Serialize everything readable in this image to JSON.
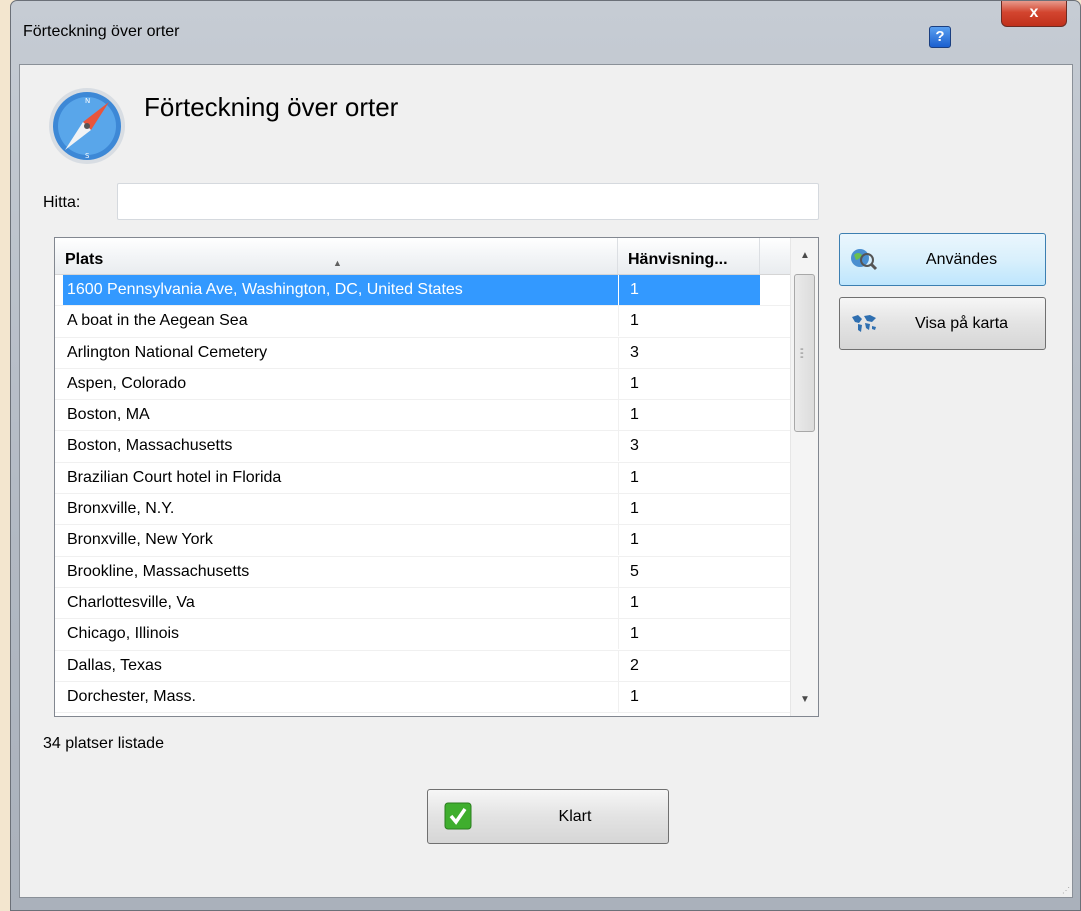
{
  "window": {
    "title": "Förteckning över orter",
    "help_label": "?",
    "close_label": "x"
  },
  "header": {
    "title": "Förteckning över orter",
    "icon": "compass-icon"
  },
  "find": {
    "label": "Hitta:",
    "value": "",
    "placeholder": ""
  },
  "table": {
    "columns": [
      "Plats",
      "Hänvisning..."
    ],
    "sort_column": "Plats",
    "selected_index": 0,
    "rows": [
      {
        "place": "1600 Pennsylvania Ave, Washington, DC, United States",
        "refs": "1"
      },
      {
        "place": "A boat in the Aegean Sea",
        "refs": "1"
      },
      {
        "place": "Arlington National Cemetery",
        "refs": "3"
      },
      {
        "place": "Aspen, Colorado",
        "refs": "1"
      },
      {
        "place": "Boston, MA",
        "refs": "1"
      },
      {
        "place": "Boston, Massachusetts",
        "refs": "3"
      },
      {
        "place": "Brazilian Court hotel in Florida",
        "refs": "1"
      },
      {
        "place": "Bronxville, N.Y.",
        "refs": "1"
      },
      {
        "place": "Bronxville, New York",
        "refs": "1"
      },
      {
        "place": "Brookline, Massachusetts",
        "refs": "5"
      },
      {
        "place": "Charlottesville, Va",
        "refs": "1"
      },
      {
        "place": "Chicago, Illinois",
        "refs": "1"
      },
      {
        "place": "Dallas, Texas",
        "refs": "2"
      },
      {
        "place": "Dorchester, Mass.",
        "refs": "1"
      }
    ]
  },
  "actions": {
    "used_label": "Användes",
    "used_icon": "search-globe-icon",
    "map_label": "Visa på karta",
    "map_icon": "world-map-icon"
  },
  "status": {
    "text": "34 platser listade"
  },
  "footer": {
    "done_label": "Klart",
    "done_icon": "green-checkmark-icon"
  },
  "colors": {
    "selection": "#3399ff",
    "close_button": "#c0301b",
    "help_button": "#1a5fcf"
  }
}
